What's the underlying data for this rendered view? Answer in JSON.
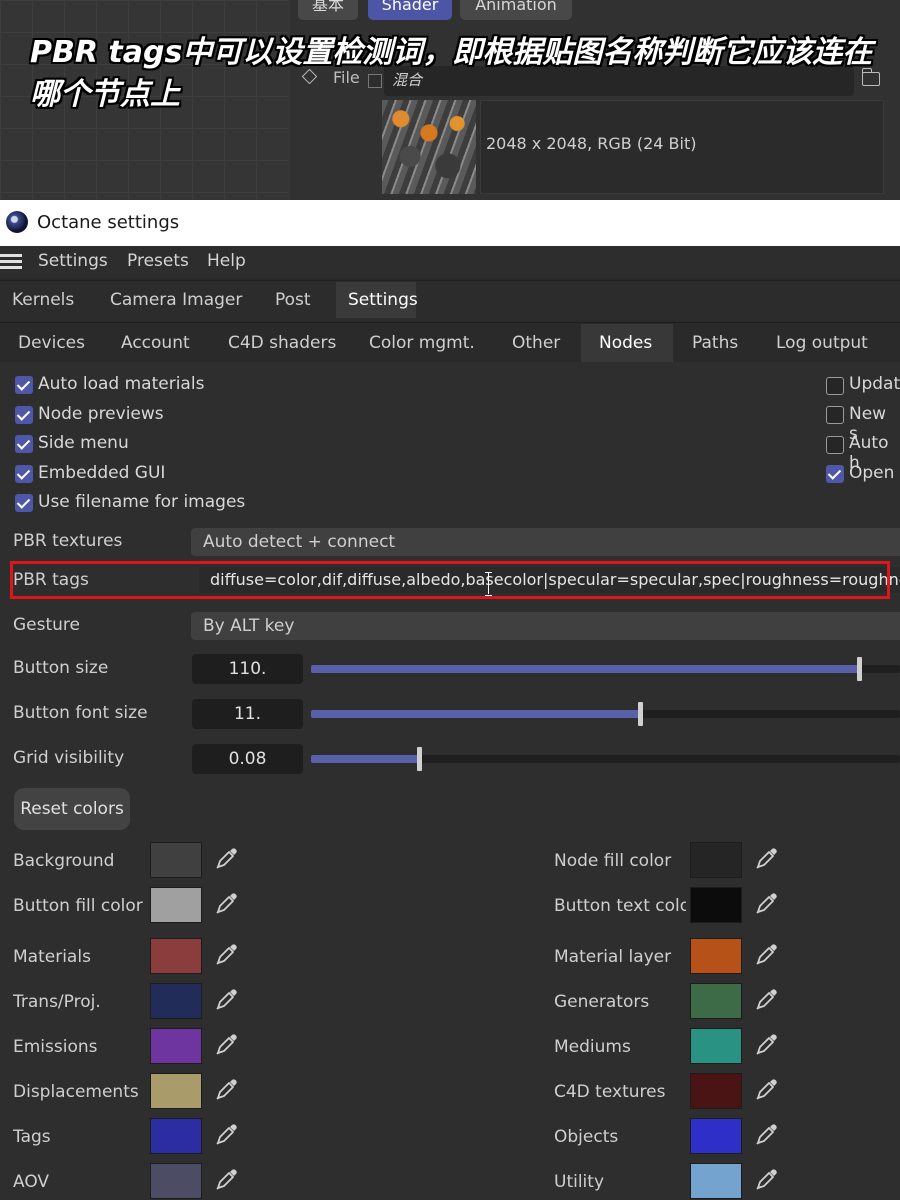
{
  "caption": "PBR tags中可以设置检测词，即根据贴图名称判断它应该连在哪个节点上",
  "material_editor": {
    "tabs": [
      "基本",
      "Shader",
      "Animation"
    ],
    "active_tab": "Shader",
    "file_label": "File",
    "file_value": "混合",
    "texture_info": "2048 x 2048, RGB (24 Bit)"
  },
  "window": {
    "title": "Octane settings"
  },
  "menu": [
    "Settings",
    "Presets",
    "Help"
  ],
  "tabs_main": [
    "Kernels",
    "Camera Imager",
    "Post",
    "Settings"
  ],
  "tabs_main_active": "Settings",
  "tabs_sub": [
    "Devices",
    "Account",
    "C4D shaders",
    "Color mgmt.",
    "Other",
    "Nodes",
    "Paths",
    "Log output"
  ],
  "tabs_sub_active": "Nodes",
  "checkboxes_left": [
    {
      "label": "Auto load materials",
      "checked": true
    },
    {
      "label": "Node previews",
      "checked": true
    },
    {
      "label": "Side menu",
      "checked": true
    },
    {
      "label": "Embedded GUI",
      "checked": true
    },
    {
      "label": "Use filename for images",
      "checked": true
    }
  ],
  "checkboxes_right": [
    {
      "label": "Updat",
      "checked": false
    },
    {
      "label": "New s",
      "checked": false
    },
    {
      "label": "Auto h",
      "checked": false
    },
    {
      "label": "Open",
      "checked": true
    }
  ],
  "pbr_textures": {
    "label": "PBR textures",
    "value": "Auto detect + connect"
  },
  "pbr_tags": {
    "label": "PBR tags",
    "value": "diffuse=color,dif,diffuse,albedo,basecolor|specular=specular,spec|roughness=roughness"
  },
  "gesture": {
    "label": "Gesture",
    "value": "By ALT key"
  },
  "sliders": [
    {
      "label": "Button size",
      "value": "110.",
      "fraction": 0.931
    },
    {
      "label": "Button font size",
      "value": "11.",
      "fraction": 0.558
    },
    {
      "label": "Grid visibility",
      "value": "0.08",
      "fraction": 0.183
    }
  ],
  "reset_colors": "Reset colors",
  "colors_left": [
    {
      "label": "Background",
      "color": "#404040"
    },
    {
      "label": "Button fill color",
      "color": "#a0a0a0"
    },
    {
      "label": "Materials",
      "color": "#8b3c3c"
    },
    {
      "label": "Trans/Proj.",
      "color": "#222c58"
    },
    {
      "label": "Emissions",
      "color": "#6e35a0"
    },
    {
      "label": "Displacements",
      "color": "#a99c6a"
    },
    {
      "label": "Tags",
      "color": "#2b2da2"
    },
    {
      "label": "AOV",
      "color": "#4c4c64"
    }
  ],
  "colors_right": [
    {
      "label": "Node fill color",
      "color": "#252525"
    },
    {
      "label": "Button text colo",
      "color": "#0c0c0c"
    },
    {
      "label": "Material layer",
      "color": "#b65218"
    },
    {
      "label": "Generators",
      "color": "#3d6b48"
    },
    {
      "label": "Mediums",
      "color": "#2a9283"
    },
    {
      "label": "C4D textures",
      "color": "#4b1414"
    },
    {
      "label": "Objects",
      "color": "#2e2ec8"
    },
    {
      "label": "Utility",
      "color": "#74a3cf"
    }
  ]
}
